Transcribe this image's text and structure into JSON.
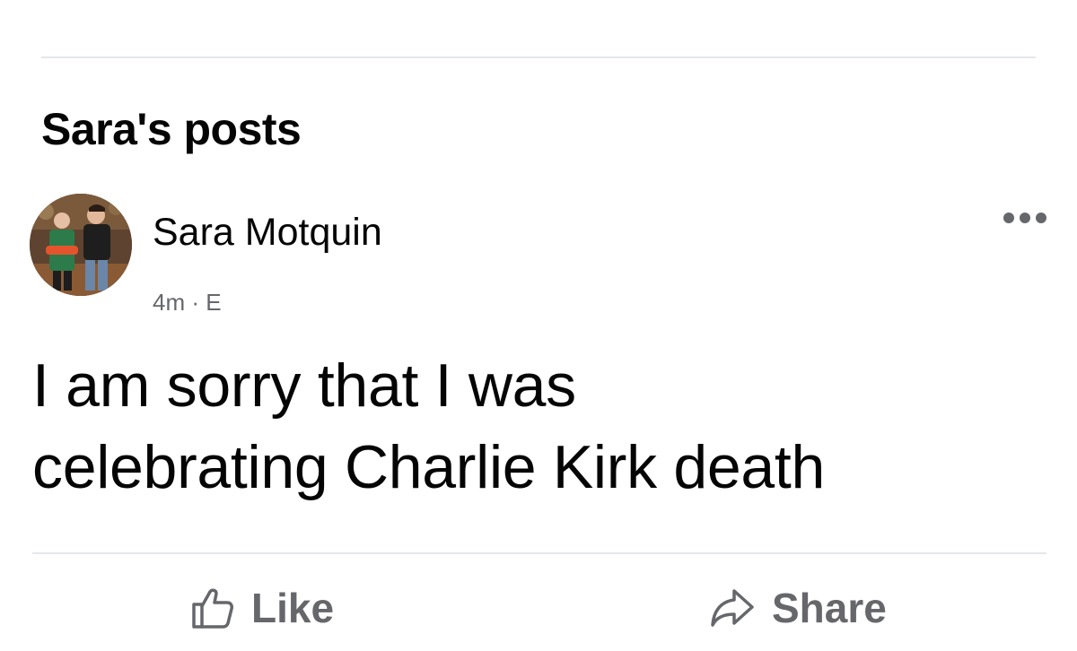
{
  "section": {
    "title": "Sara's posts"
  },
  "post": {
    "author": "Sara Motquin",
    "meta": "4m · E",
    "text_line1": "I am sorry that I was",
    "text_line2": "celebrating Charlie Kirk death",
    "more_icon": "more-horizontal-icon"
  },
  "actions": {
    "like_label": "Like",
    "like_icon": "thumbs-up-icon",
    "share_label": "Share",
    "share_icon": "share-arrow-icon"
  },
  "colors": {
    "text_primary": "#050505",
    "text_secondary": "#65676b",
    "divider": "#e4e6eb"
  }
}
